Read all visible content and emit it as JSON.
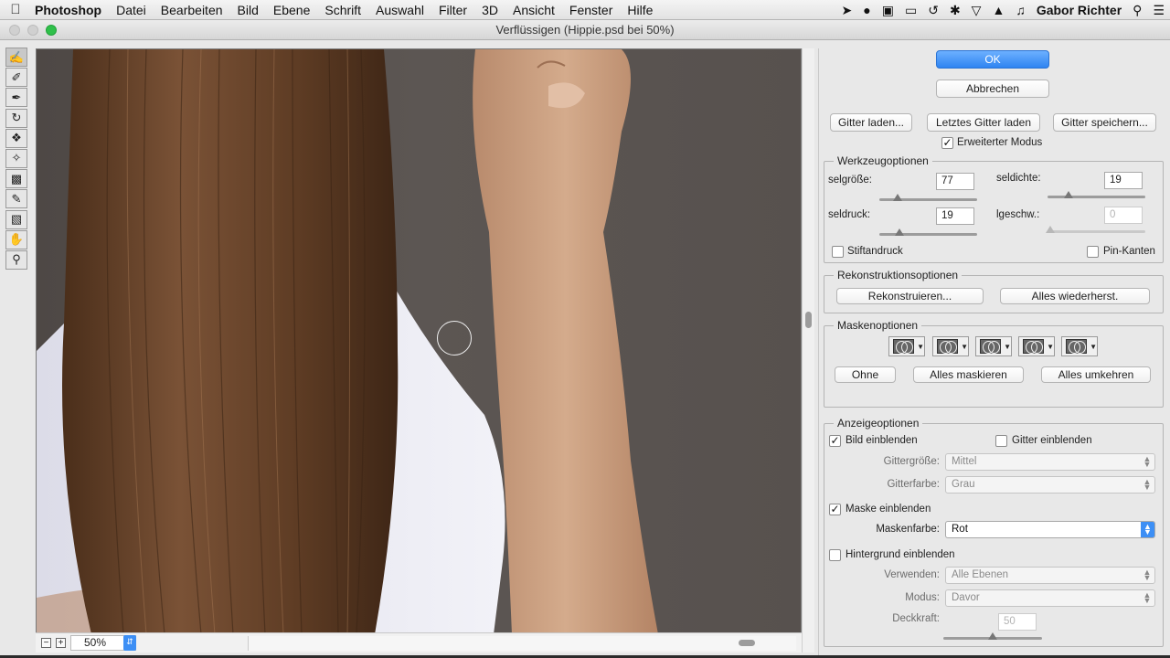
{
  "menubar": {
    "app": "Photoshop",
    "items": [
      "Datei",
      "Bearbeiten",
      "Bild",
      "Ebene",
      "Schrift",
      "Auswahl",
      "Filter",
      "3D",
      "Ansicht",
      "Fenster",
      "Hilfe"
    ],
    "user": "Gabor Richter"
  },
  "window": {
    "title": "Verflüssigen (Hippie.psd bei 50%)"
  },
  "status": {
    "zoom": "50%"
  },
  "panel": {
    "ok": "OK",
    "cancel": "Abbrechen",
    "load_mesh": "Gitter laden...",
    "load_last_mesh": "Letztes Gitter laden",
    "save_mesh": "Gitter speichern...",
    "advanced_mode": "Erweiterter Modus",
    "tool_options": {
      "legend": "Werkzeugoptionen",
      "size_label": "selgröße:",
      "size_value": "77",
      "density_label": "seldichte:",
      "density_value": "19",
      "pressure_label": "seldruck:",
      "pressure_value": "19",
      "rate_label": "lgeschw.:",
      "rate_value": "0",
      "stylus_pressure": "Stiftandruck",
      "pin_edges": "Pin-Kanten"
    },
    "reconstruct": {
      "legend": "Rekonstruktionsoptionen",
      "reconstruct_btn": "Rekonstruieren...",
      "restore_all_btn": "Alles wiederherst."
    },
    "mask": {
      "legend": "Maskenoptionen",
      "none_btn": "Ohne",
      "mask_all_btn": "Alles maskieren",
      "invert_all_btn": "Alles umkehren"
    },
    "view": {
      "legend": "Anzeigeoptionen",
      "show_image": "Bild einblenden",
      "show_mesh": "Gitter einblenden",
      "mesh_size_label": "Gittergröße:",
      "mesh_size_value": "Mittel",
      "mesh_color_label": "Gitterfarbe:",
      "mesh_color_value": "Grau",
      "show_mask": "Maske einblenden",
      "mask_color_label": "Maskenfarbe:",
      "mask_color_value": "Rot",
      "show_backdrop": "Hintergrund einblenden",
      "use_label": "Verwenden:",
      "use_value": "Alle Ebenen",
      "mode_label": "Modus:",
      "mode_value": "Davor",
      "opacity_label": "Deckkraft:",
      "opacity_value": "50"
    }
  },
  "colors": {
    "accent": "#2f84f1",
    "hair": "#6b4428",
    "shirt": "#e6e6f0",
    "skin": "#caa183",
    "background": "#524b48"
  }
}
